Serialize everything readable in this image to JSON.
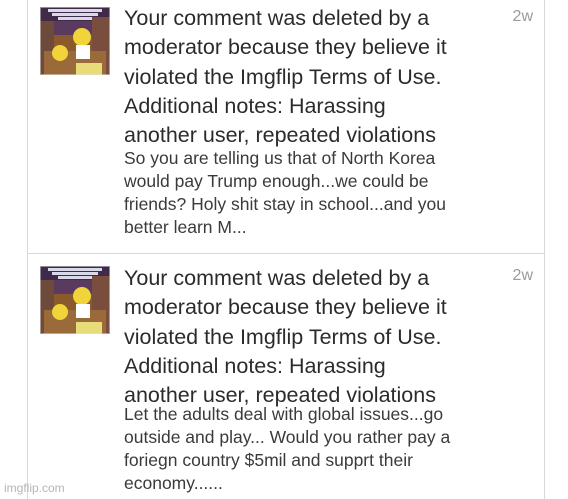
{
  "notifications": [
    {
      "message": "Your comment was deleted by a\nmoderator because they believe it\nviolated the Imgflip Terms of Use.\nAdditional notes: Harassing\nanother user, repeated violations",
      "comment_excerpt": "So you are telling us that of North Korea\nwould pay Trump enough...we could be\nfriends? Holy shit stay in school...and you\nbetter learn M...",
      "time": "2w",
      "thumbnail_icon": "meme-thumbnail-icon"
    },
    {
      "message": "Your comment was deleted by a\nmoderator because they believe it\nviolated the Imgflip Terms of Use.\nAdditional notes: Harassing\nanother user, repeated violations",
      "comment_excerpt": "Let the adults deal with global issues...go\noutside and play... Would you rather pay a\nforiegn country $5mil and supprt their\neconomy......",
      "time": "2w",
      "thumbnail_icon": "meme-thumbnail-icon"
    }
  ],
  "watermark": "imgflip.com"
}
